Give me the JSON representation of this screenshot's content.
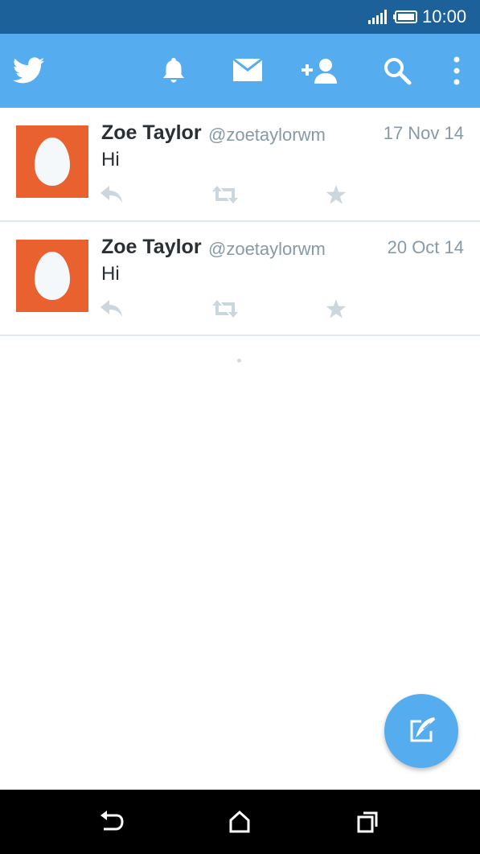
{
  "status_bar": {
    "time": "10:00",
    "icons": [
      "signal-icon",
      "battery-icon"
    ]
  },
  "app_bar": {
    "logo": "twitter-bird-icon",
    "actions": [
      "notifications-bell-icon",
      "messages-envelope-icon",
      "follow-add-user-icon",
      "search-icon",
      "overflow-menu-icon"
    ]
  },
  "colors": {
    "status_bar": "#1c6199",
    "brand": "#55acee",
    "avatar_bg": "#ea6130",
    "text_primary": "#292f33",
    "text_secondary": "#8899a6",
    "action_icon": "#ccd6dd",
    "divider": "#e1e8ed"
  },
  "tweets": [
    {
      "name": "Zoe Taylor",
      "handle": "@zoetaylorwm",
      "date": "17 Nov 14",
      "text": "Hi",
      "actions": [
        "reply-icon",
        "retweet-icon",
        "favorite-star-icon"
      ]
    },
    {
      "name": "Zoe Taylor",
      "handle": "@zoetaylorwm",
      "date": "20 Oct 14",
      "text": "Hi",
      "actions": [
        "reply-icon",
        "retweet-icon",
        "favorite-star-icon"
      ]
    }
  ],
  "fab": {
    "icon": "compose-tweet-icon"
  },
  "nav_bar": {
    "buttons": [
      "back-icon",
      "home-icon",
      "recents-icon"
    ]
  }
}
